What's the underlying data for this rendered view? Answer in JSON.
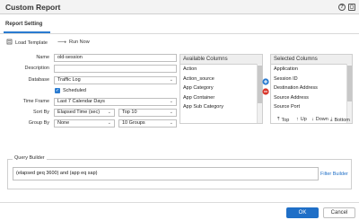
{
  "window": {
    "title": "Custom Report"
  },
  "tabs": [
    {
      "label": "Report Setting"
    }
  ],
  "toolbar": {
    "load_template": "Load Template",
    "run_now": "Run Now"
  },
  "form": {
    "name_label": "Name",
    "name_value": "old-session",
    "description_label": "Description",
    "description_value": "",
    "database_label": "Database",
    "database_value": "Traffic Log",
    "scheduled_label": "Scheduled",
    "time_frame_label": "Time Frame",
    "time_frame_value": "Last 7 Calendar Days",
    "sort_by_label": "Sort By",
    "sort_by_value": "Elapsed Time (sec)",
    "sort_top_value": "Top 10",
    "group_by_label": "Group By",
    "group_by_value": "None",
    "group_count_value": "10 Groups"
  },
  "available_columns": {
    "header": "Available Columns",
    "items": [
      "Action",
      "Action_source",
      "App Category",
      "App Container",
      "App Sub Category"
    ]
  },
  "selected_columns": {
    "header": "Selected Columns",
    "items": [
      "Application",
      "Session ID",
      "Destination Address",
      "Source Address",
      "Source Port"
    ]
  },
  "sort_buttons": {
    "top": "Top",
    "up": "Up",
    "down": "Down",
    "bottom": "Bottom"
  },
  "query_builder": {
    "label": "Query Builder",
    "query": "(elapsed geq 3600) and (app eq sap)",
    "filter_builder": "Filter Builder"
  },
  "footer": {
    "ok": "OK",
    "cancel": "Cancel"
  },
  "colors": {
    "accent": "#1f6fc7",
    "add": "#2a7bd0",
    "remove": "#d9362b"
  }
}
